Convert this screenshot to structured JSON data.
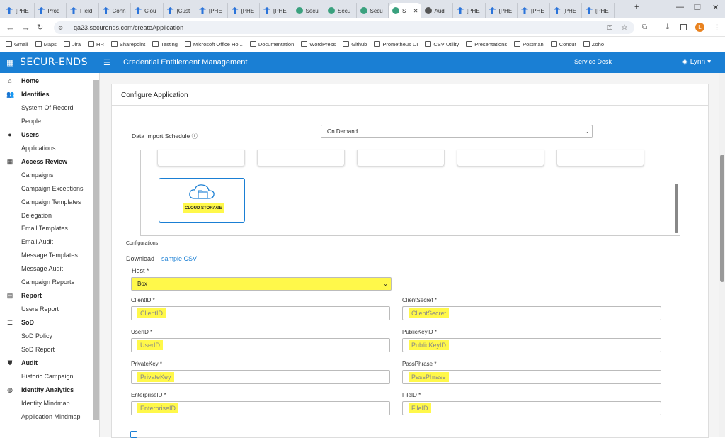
{
  "browser": {
    "tabs": [
      {
        "label": "[PHE",
        "icon": "jira-icon",
        "active": false
      },
      {
        "label": "Prod",
        "icon": "jira-icon",
        "active": false
      },
      {
        "label": "Field",
        "icon": "jira-icon",
        "active": false
      },
      {
        "label": "Conn",
        "icon": "jira-icon",
        "active": false
      },
      {
        "label": "Clou",
        "icon": "jira-icon",
        "active": false
      },
      {
        "label": "[Cust",
        "icon": "jira-icon",
        "active": false
      },
      {
        "label": "[PHE",
        "icon": "jira-icon",
        "active": false
      },
      {
        "label": "[PHE",
        "icon": "jira-icon",
        "active": false
      },
      {
        "label": "[PHE",
        "icon": "jira-icon",
        "active": false
      },
      {
        "label": "Secu",
        "icon": "securends-icon",
        "active": false
      },
      {
        "label": "Secu",
        "icon": "securends-icon",
        "active": false
      },
      {
        "label": "Secu",
        "icon": "securends-icon",
        "active": false
      },
      {
        "label": "S",
        "icon": "securends-icon",
        "active": true
      },
      {
        "label": "Audi",
        "icon": "globe-icon",
        "active": false
      },
      {
        "label": "[PHE",
        "icon": "jira-icon",
        "active": false
      },
      {
        "label": "[PHE",
        "icon": "jira-icon",
        "active": false
      },
      {
        "label": "[PHE",
        "icon": "jira-icon",
        "active": false
      },
      {
        "label": "[PHE",
        "icon": "jira-icon",
        "active": false
      },
      {
        "label": "[PHE",
        "icon": "jira-icon",
        "active": false
      }
    ],
    "url": "qa23.securends.com/createApplication",
    "profile_initial": "L",
    "bookmarks": [
      "Gmail",
      "Maps",
      "Jira",
      "HR",
      "Sharepoint",
      "Testing",
      "Microsoft Office Ho...",
      "Documentation",
      "WordPress",
      "Github",
      "Prometheus UI",
      "CSV Utility",
      "Presentations",
      "Postman",
      "Concur",
      "Zoho"
    ]
  },
  "header": {
    "logo": "SECUR-ENDS",
    "title": "Credential Entitlement Management",
    "service_desk": "Service Desk",
    "user": "Lynn"
  },
  "sidebar": {
    "items": [
      {
        "label": "Home",
        "header": true,
        "icon": "home-icon",
        "glyph": "⌂"
      },
      {
        "label": "Identities",
        "header": true,
        "icon": "people-icon",
        "glyph": "👥"
      },
      {
        "label": "System Of Record",
        "header": false
      },
      {
        "label": "People",
        "header": false
      },
      {
        "label": "Users",
        "header": true,
        "icon": "user-icon",
        "glyph": "●"
      },
      {
        "label": "Applications",
        "header": false
      },
      {
        "label": "Access Review",
        "header": true,
        "icon": "grid-icon",
        "glyph": "▦"
      },
      {
        "label": "Campaigns",
        "header": false
      },
      {
        "label": "Campaign Exceptions",
        "header": false
      },
      {
        "label": "Campaign Templates",
        "header": false
      },
      {
        "label": "Delegation",
        "header": false
      },
      {
        "label": "Email Templates",
        "header": false
      },
      {
        "label": "Email Audit",
        "header": false
      },
      {
        "label": "Message Templates",
        "header": false
      },
      {
        "label": "Message Audit",
        "header": false
      },
      {
        "label": "Campaign Reports",
        "header": false
      },
      {
        "label": "Report",
        "header": true,
        "icon": "file-icon",
        "glyph": "▤"
      },
      {
        "label": "Users Report",
        "header": false
      },
      {
        "label": "SoD",
        "header": true,
        "icon": "list-icon",
        "glyph": "☰"
      },
      {
        "label": "SoD Policy",
        "header": false
      },
      {
        "label": "SoD Report",
        "header": false
      },
      {
        "label": "Audit",
        "header": true,
        "icon": "shield-icon",
        "glyph": "⛊"
      },
      {
        "label": "Historic Campaign",
        "header": false
      },
      {
        "label": "Identity Analytics",
        "header": true,
        "icon": "analytics-icon",
        "glyph": "◍"
      },
      {
        "label": "Identity Mindmap",
        "header": false
      },
      {
        "label": "Application Mindmap",
        "header": false
      }
    ]
  },
  "form": {
    "section_title": "Configure Application",
    "import_schedule_label": "Data Import Schedule",
    "import_schedule_value": "On Demand",
    "cloud_storage_label": "CLOUD STORAGE",
    "configurations_label": "Configurations",
    "download_label": "Download",
    "sample_csv_link": "sample CSV",
    "host_label": "Host *",
    "host_value": "Box",
    "fields": [
      {
        "label": "ClientID *",
        "placeholder": "ClientID"
      },
      {
        "label": "ClientSecret *",
        "placeholder": "ClientSecret"
      },
      {
        "label": "UserID *",
        "placeholder": "UserID"
      },
      {
        "label": "PublicKeyID *",
        "placeholder": "PublicKeyID"
      },
      {
        "label": "PrivateKey *",
        "placeholder": "PrivateKey"
      },
      {
        "label": "PassPhrase *",
        "placeholder": "PassPhrase"
      },
      {
        "label": "EnterpriseID *",
        "placeholder": "EnterpriseID"
      },
      {
        "label": "FileID *",
        "placeholder": "FileID"
      }
    ]
  },
  "colors": {
    "header": "#1a7fd4",
    "highlight": "#fff84a",
    "link": "#1a7fd4"
  }
}
